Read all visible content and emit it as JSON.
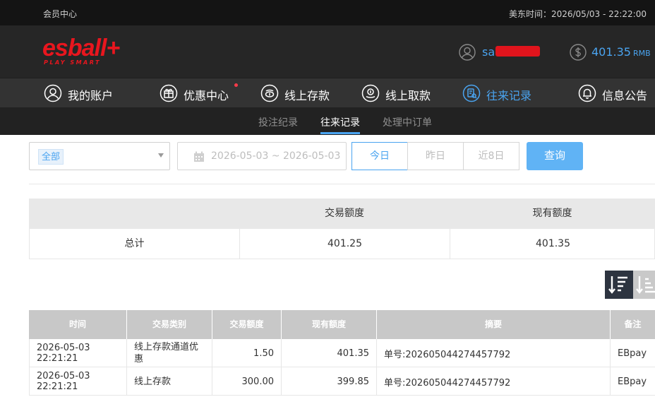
{
  "topbar": {
    "title": "会员中心",
    "time_label": "美东时间：",
    "time_value": "2026/05/03 - 22:22:00"
  },
  "header": {
    "logo_text": "esball+",
    "logo_tagline": "PLAY SMART",
    "username": "sa",
    "balance": "401.35",
    "currency": "RMB"
  },
  "nav": {
    "items": [
      {
        "label": "我的账户",
        "icon": "user-circle-icon"
      },
      {
        "label": "优惠中心",
        "icon": "gift-icon"
      },
      {
        "label": "线上存款",
        "icon": "deposit-icon"
      },
      {
        "label": "线上取款",
        "icon": "withdraw-icon"
      },
      {
        "label": "往来记录",
        "icon": "records-icon"
      },
      {
        "label": "信息公告",
        "icon": "bell-icon"
      }
    ],
    "active": "往来记录"
  },
  "subtabs": {
    "items": [
      "投注纪录",
      "往来记录",
      "处理中订单"
    ],
    "active": "往来记录"
  },
  "filters": {
    "type_selected": "全部",
    "date_range": "2026-05-03 ~ 2026-05-03",
    "quick": [
      "今日",
      "昨日",
      "近8日"
    ],
    "quick_active": "今日",
    "query_label": "查询"
  },
  "summary": {
    "headers": [
      "",
      "交易额度",
      "现有额度"
    ],
    "row_label": "总计",
    "transaction_amount": "401.25",
    "current_amount": "401.35"
  },
  "records": {
    "headers": [
      "时间",
      "交易类别",
      "交易额度",
      "现有额度",
      "摘要",
      "备注"
    ],
    "rows": [
      {
        "time": "2026-05-03 22:21:21",
        "type": "线上存款通道优惠",
        "amount": "1.50",
        "balance": "401.35",
        "summary": "单号:202605044274457792",
        "note": "EBpay"
      },
      {
        "time": "2026-05-03 22:21:21",
        "type": "线上存款",
        "amount": "300.00",
        "balance": "399.85",
        "summary": "单号:202605044274457792",
        "note": "EBpay"
      }
    ]
  },
  "colors": {
    "accent": "#4aa4f0",
    "brand_red": "#e8161e",
    "topbar_bg": "#141414",
    "header_bg": "#262626",
    "nav_bg": "#333333"
  }
}
